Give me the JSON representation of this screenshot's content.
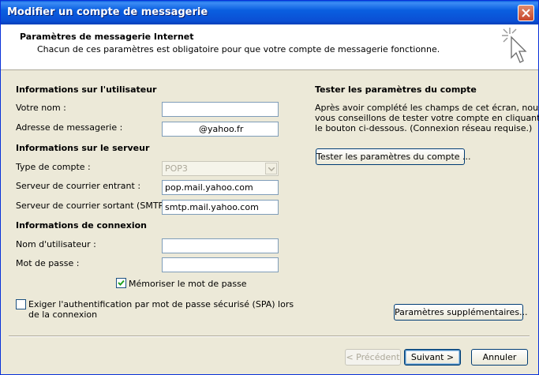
{
  "window": {
    "title": "Modifier un compte de messagerie"
  },
  "header": {
    "title": "Paramètres de messagerie Internet",
    "subtitle": "Chacun de ces paramètres est obligatoire pour que votre compte de messagerie fonctionne."
  },
  "user_section": {
    "title": "Informations sur l'utilisateur",
    "name_label": "Votre nom :",
    "name_value": "",
    "email_label": "Adresse de messagerie :",
    "email_value": "@yahoo.fr"
  },
  "server_section": {
    "title": "Informations sur le serveur",
    "account_type_label": "Type de compte :",
    "account_type_value": "POP3",
    "incoming_label": "Serveur de courrier entrant :",
    "incoming_value": "pop.mail.yahoo.com",
    "outgoing_label": "Serveur de courrier sortant (SMTP) :",
    "outgoing_value": "smtp.mail.yahoo.com"
  },
  "login_section": {
    "title": "Informations de connexion",
    "username_label": "Nom d'utilisateur :",
    "username_value": "",
    "password_label": "Mot de passe :",
    "password_value": "",
    "remember_label": "Mémoriser le mot de passe",
    "remember_checked": true,
    "spa_label_line1": "Exiger l'authentification par mot de passe sécurisé (SPA) lors",
    "spa_label_line2": "de la connexion",
    "spa_checked": false
  },
  "test_section": {
    "title": "Tester les paramètres du compte",
    "description_line1": "Après avoir complété les champs de cet écran, nous",
    "description_line2": "vous conseillons de tester votre compte en cliquant sur",
    "description_line3": "le bouton ci-dessous. (Connexion réseau requise.)",
    "test_button": "Tester les paramètres du compte ...",
    "more_settings_button": "Paramètres supplémentaires..."
  },
  "footer": {
    "back_button": "< Précédent",
    "next_button": "Suivant >",
    "cancel_button": "Annuler"
  },
  "colors": {
    "title_bar": "#0a5fe0",
    "dialog_bg": "#ece9d8",
    "field_border": "#7f9db9"
  }
}
